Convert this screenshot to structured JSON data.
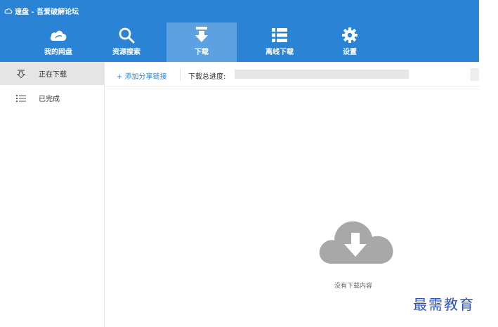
{
  "window": {
    "title": "速盘 - 吾爱破解论坛"
  },
  "nav": {
    "items": [
      {
        "label": "我的网盘",
        "icon": "cloud-icon"
      },
      {
        "label": "资源搜索",
        "icon": "search-icon"
      },
      {
        "label": "下载",
        "icon": "download-icon",
        "active": true
      },
      {
        "label": "离线下载",
        "icon": "list-icon"
      },
      {
        "label": "设置",
        "icon": "gear-icon"
      }
    ]
  },
  "sidebar": {
    "items": [
      {
        "label": "正在下载",
        "icon": "downloading-icon",
        "active": true
      },
      {
        "label": "已完成",
        "icon": "completed-list-icon"
      }
    ]
  },
  "toolbar": {
    "add_share_link": "+ 添加分享链接",
    "progress_label": "下载总进度:",
    "progress": 0
  },
  "content": {
    "empty_message": "没有下载内容"
  },
  "watermark": "最需教育",
  "colors": {
    "header": "#2b83d6",
    "nav_active": "#5ca2e3",
    "sidebar_active": "#e5e5e5",
    "empty_icon": "#a8a8a8"
  }
}
